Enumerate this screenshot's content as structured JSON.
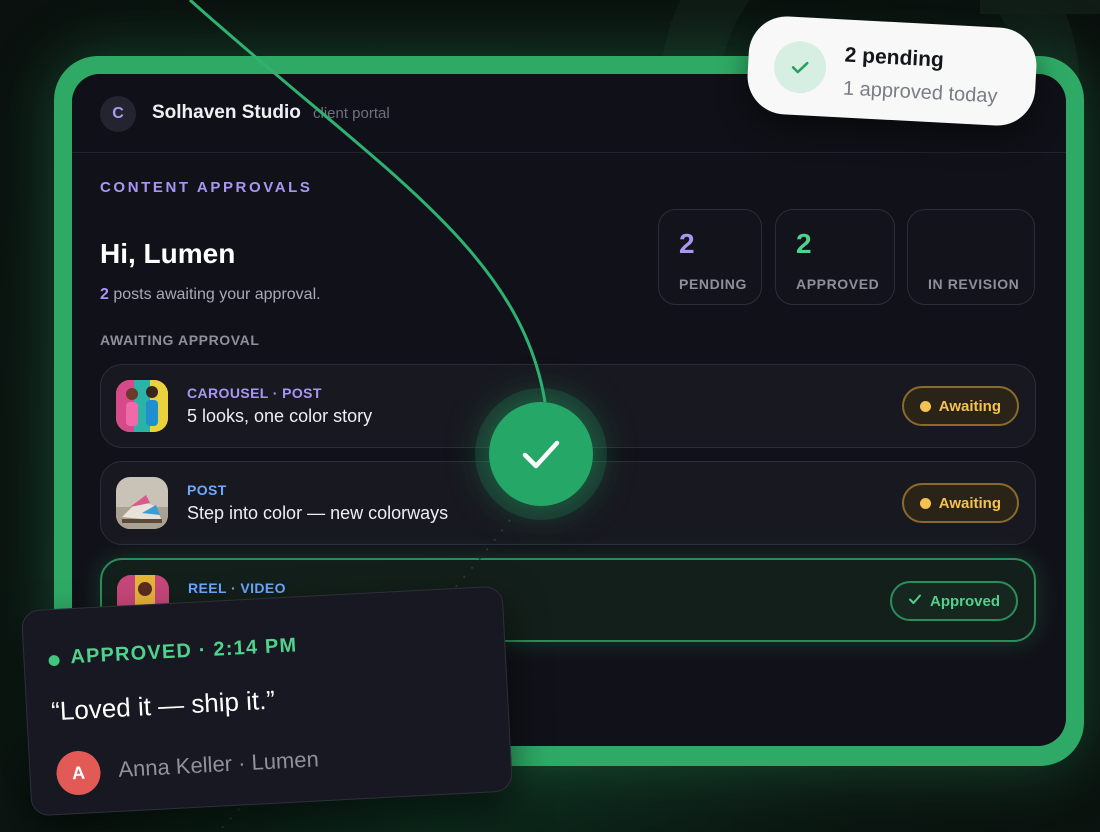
{
  "brand": {
    "initial": "C",
    "name": "Solhaven Studio",
    "subtitle": "client portal"
  },
  "section_label": "CONTENT APPROVALS",
  "greeting": "Hi, Lumen",
  "summary": {
    "count": "2",
    "text": " posts awaiting your approval."
  },
  "stats": [
    {
      "value": "2",
      "label": "PENDING",
      "color": "#a996f4"
    },
    {
      "value": "2",
      "label": "APPROVED",
      "color": "#4fd28c"
    },
    {
      "value": "",
      "label": "IN REVISION",
      "color": "#8d909b"
    }
  ],
  "list_label": "AWAITING APPROVAL",
  "posts": [
    {
      "type": "CAROUSEL · POST",
      "type_color": "#a996f4",
      "title": "5 looks, one color story",
      "status": "Awaiting"
    },
    {
      "type": "POST",
      "type_color": "#6ea8ff",
      "title": "Step into color — new colorways",
      "status": "Awaiting"
    },
    {
      "type": "REEL · VIDEO",
      "type_color": "#6ea8ff",
      "title": "",
      "status": "Approved"
    }
  ],
  "toast": {
    "title": "2 pending",
    "subtitle": "1 approved today",
    "icon": "check-icon"
  },
  "approval_card": {
    "status": "APPROVED · 2:14 PM",
    "quote": "“Loved it — ship it.”",
    "author_initial": "A",
    "author": "Anna Keller · Lumen"
  },
  "colors": {
    "accent_green": "#2faa66",
    "accent_purple": "#a996f4",
    "awaiting_yellow": "#f5c251"
  }
}
